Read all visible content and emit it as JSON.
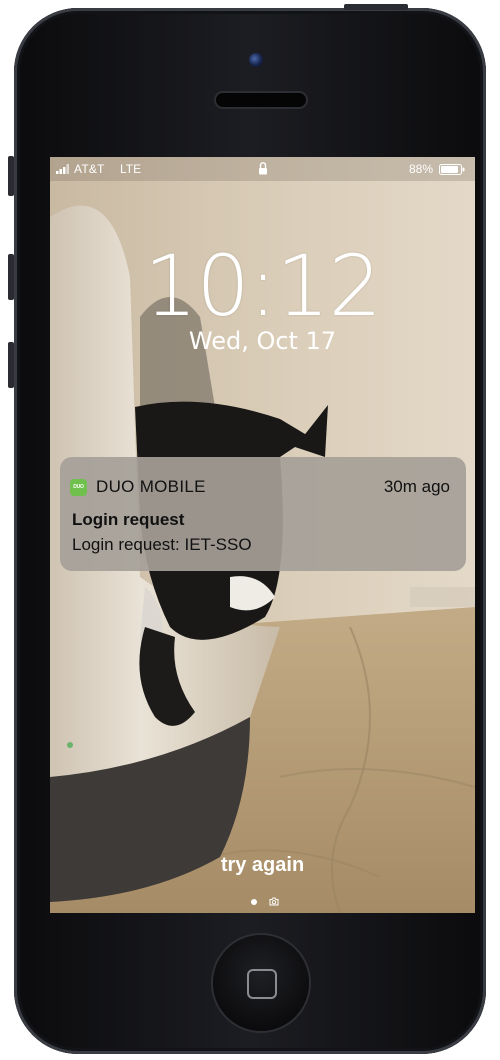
{
  "status_bar": {
    "carrier": "AT&T",
    "network": "LTE",
    "battery_percent": "88%",
    "signal_icon": "signal-bars-icon",
    "lock_icon": "lock-icon",
    "battery_icon": "battery-icon"
  },
  "lock_screen": {
    "time": "10:12",
    "date": "Wed, Oct 17",
    "hint": "try again"
  },
  "notification": {
    "app_icon": "duo-app-icon",
    "app_icon_text": "DUO",
    "app_name": "DUO MOBILE",
    "time_ago": "30m ago",
    "title": "Login request",
    "body": "Login request: IET-SSO"
  },
  "colors": {
    "duo_green": "#6fc04c",
    "notification_bg": "#a5a098"
  }
}
